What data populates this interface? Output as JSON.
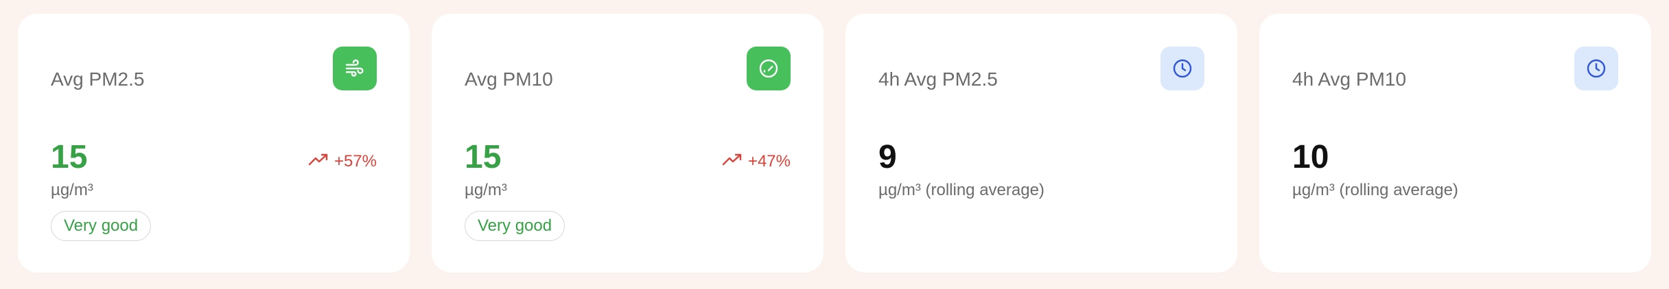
{
  "cards": [
    {
      "title": "Avg PM2.5",
      "icon": "wind-icon",
      "value": "15",
      "unit": "µg/m³",
      "trend": "+57%",
      "badge": "Very good"
    },
    {
      "title": "Avg PM10",
      "icon": "gauge-icon",
      "value": "15",
      "unit": "µg/m³",
      "trend": "+47%",
      "badge": "Very good"
    },
    {
      "title": "4h Avg PM2.5",
      "icon": "clock-icon",
      "value": "9",
      "unit": "µg/m³ (rolling average)"
    },
    {
      "title": "4h Avg PM10",
      "icon": "clock-icon",
      "value": "10",
      "unit": "µg/m³ (rolling average)"
    }
  ],
  "colors": {
    "good_green": "#37a146",
    "icon_green": "#47bf5a",
    "trend_up_red": "#d9443a",
    "clock_blue": "#2f56d9",
    "clock_bg": "#dce8fb",
    "page_bg": "#fdf3ee"
  }
}
